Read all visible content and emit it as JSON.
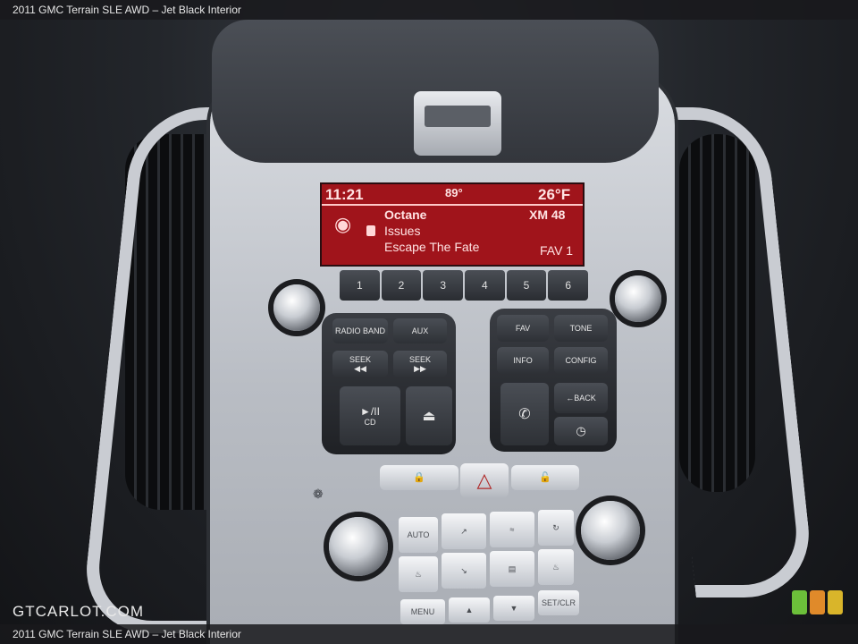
{
  "caption": "2011 GMC Terrain SLE AWD – Jet Black Interior",
  "watermark": "GTCARLOT.COM",
  "radio_display": {
    "time": "11:21",
    "inside_temp": "89°",
    "outside_temp": "26°F",
    "station": "Octane",
    "channel": "XM 48",
    "artist": "Issues",
    "song": "Escape The Fate",
    "favorite": "FAV 1"
  },
  "presets": [
    "1",
    "2",
    "3",
    "4",
    "5",
    "6"
  ],
  "left_keys": {
    "radio_band": "RADIO BAND",
    "aux": "AUX",
    "seek_back": "SEEK",
    "seek_forward": "SEEK",
    "play_pause": "►/II",
    "eject": "⏏",
    "cd": "CD"
  },
  "right_keys": {
    "fav": "FAV",
    "tone": "TONE",
    "info": "INFO",
    "config": "CONFIG",
    "back": "←BACK"
  },
  "climate_keys": {
    "auto": "AUTO",
    "menu": "MENU",
    "set_clr": "SET/CLR",
    "up": "▲",
    "down": "▼"
  },
  "colors": {
    "display_red": "#a0141b",
    "trim_silver": "#c9ccd2",
    "dark_interior": "#1a1c20"
  }
}
